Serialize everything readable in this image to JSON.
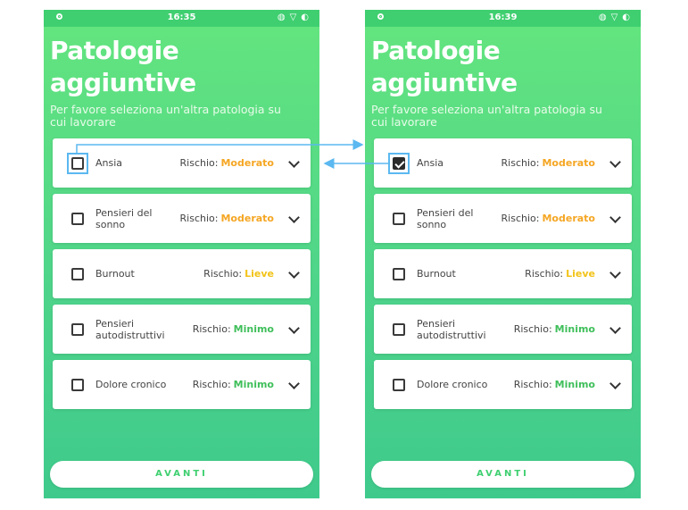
{
  "screens": [
    {
      "status_time": "16:35",
      "title_line1": "Patologie",
      "title_line2": "aggiuntive",
      "subtitle": "Per favore seleziona un'altra patologia su cui lavorare",
      "items": [
        {
          "label": "Ansia",
          "risk_prefix": "Rischio:",
          "risk_level": "Moderato",
          "risk_color": "#f5a623",
          "checked": false
        },
        {
          "label": "Pensieri del sonno",
          "risk_prefix": "Rischio:",
          "risk_level": "Moderato",
          "risk_color": "#f5a623",
          "checked": false
        },
        {
          "label": "Burnout",
          "risk_prefix": "Rischio:",
          "risk_level": "Lieve",
          "risk_color": "#f2c318",
          "checked": false
        },
        {
          "label": "Pensieri autodistruttivi",
          "risk_prefix": "Rischio:",
          "risk_level": "Minimo",
          "risk_color": "#3fbf5a",
          "checked": false
        },
        {
          "label": "Dolore cronico",
          "risk_prefix": "Rischio:",
          "risk_level": "Minimo",
          "risk_color": "#3fbf5a",
          "checked": false
        }
      ],
      "button_label": "AVANTI"
    },
    {
      "status_time": "16:39",
      "title_line1": "Patologie",
      "title_line2": "aggiuntive",
      "subtitle": "Per favore seleziona un'altra patologia su cui lavorare",
      "items": [
        {
          "label": "Ansia",
          "risk_prefix": "Rischio:",
          "risk_level": "Moderato",
          "risk_color": "#f5a623",
          "checked": true
        },
        {
          "label": "Pensieri del sonno",
          "risk_prefix": "Rischio:",
          "risk_level": "Moderato",
          "risk_color": "#f5a623",
          "checked": false
        },
        {
          "label": "Burnout",
          "risk_prefix": "Rischio:",
          "risk_level": "Lieve",
          "risk_color": "#f2c318",
          "checked": false
        },
        {
          "label": "Pensieri autodistruttivi",
          "risk_prefix": "Rischio:",
          "risk_level": "Minimo",
          "risk_color": "#3fbf5a",
          "checked": false
        },
        {
          "label": "Dolore cronico",
          "risk_prefix": "Rischio:",
          "risk_level": "Minimo",
          "risk_color": "#3fbf5a",
          "checked": false
        }
      ],
      "button_label": "AVANTI"
    }
  ],
  "colors": {
    "background_gradient_top": "#64e57e",
    "background_gradient_bottom": "#3fca8c",
    "annotation_arrow": "#5bb8f0"
  },
  "icons": {
    "status_left": "circle-dot-icon",
    "status_right": [
      "vibrate-icon",
      "wifi-icon",
      "battery-icon"
    ],
    "item_expand": "chevron-down-icon"
  }
}
